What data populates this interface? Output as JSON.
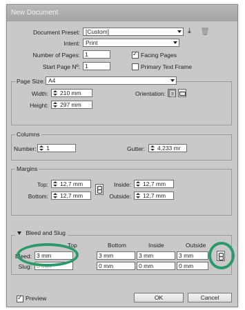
{
  "window": {
    "title": "New Document"
  },
  "preset": {
    "label": "Document Preset:",
    "value": "[Custom]"
  },
  "intent": {
    "label": "Intent:",
    "value": "Print"
  },
  "pages": {
    "count_label": "Number of Pages:",
    "count_value": "1",
    "start_label": "Start Page Nº:",
    "start_value": "1",
    "facing_label": "Facing Pages",
    "facing_checked": true,
    "primary_label": "Primary Text Frame",
    "primary_checked": false
  },
  "page_size": {
    "label": "Page Size:",
    "value": "A4",
    "width_label": "Width:",
    "width_value": "210 mm",
    "height_label": "Height:",
    "height_value": "297 mm",
    "orientation_label": "Orientation:"
  },
  "columns": {
    "title": "Columns",
    "number_label": "Number:",
    "number_value": "1",
    "gutter_label": "Gutter:",
    "gutter_value": "4,233 mr"
  },
  "margins": {
    "title": "Margins",
    "top_label": "Top:",
    "top_value": "12,7 mm",
    "bottom_label": "Bottom:",
    "bottom_value": "12,7 mm",
    "inside_label": "Inside:",
    "inside_value": "12,7 mm",
    "outside_label": "Outside:",
    "outside_value": "12,7 mm"
  },
  "bleed_slug": {
    "title": "Bleed and Slug",
    "col_top": "Top",
    "col_bottom": "Bottom",
    "col_inside": "Inside",
    "col_outside": "Outside",
    "bleed_label": "Bleed:",
    "bleed": [
      "3 mm",
      "3 mm",
      "3 mm",
      "3 mm"
    ],
    "slug_label": "Slug:",
    "slug": [
      "0 mm",
      "0 mm",
      "0 mm",
      "0 mm"
    ]
  },
  "footer": {
    "preview_label": "Preview",
    "preview_checked": true,
    "ok_label": "OK",
    "cancel_label": "Cancel"
  },
  "colors": {
    "highlight": "#2a9a6a",
    "dialog_bg": "#c9c9c9"
  }
}
